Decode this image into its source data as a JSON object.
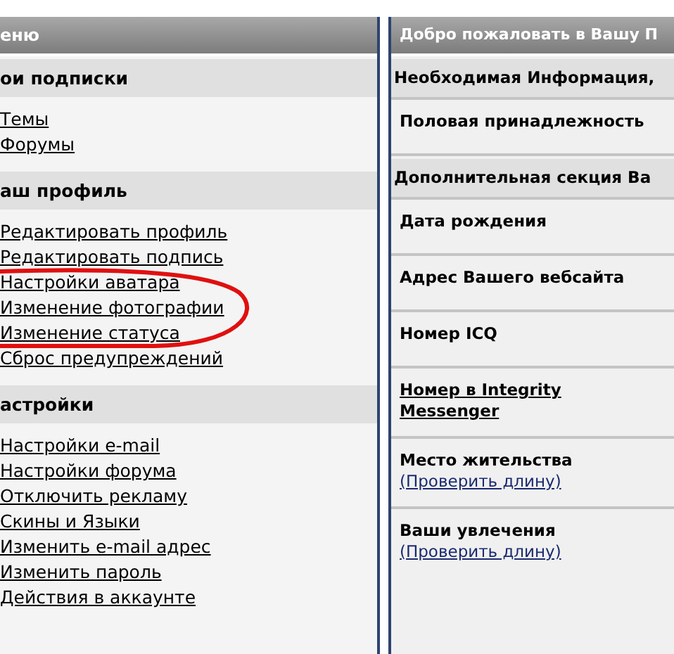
{
  "left_panel": {
    "title": "еню",
    "sections": [
      {
        "title": "ои подписки",
        "links": [
          "Темы",
          "Форумы"
        ]
      },
      {
        "title": "аш профиль",
        "links": [
          "Редактировать профиль",
          "Редактировать подпись",
          "Настройки аватара",
          "Изменение фотографии",
          "Изменение статуса",
          "Сброс предупреждений"
        ]
      },
      {
        "title": "астройки",
        "links": [
          "Настройки e-mail",
          "Настройки форума",
          "Отключить рекламу",
          "Скины и Языки",
          "Изменить e-mail адрес",
          "Изменить пароль",
          "Действия в аккаунте"
        ]
      }
    ]
  },
  "right_panel": {
    "title": "Добро пожаловать в Вашу П",
    "groups": [
      {
        "title": "Необходимая Информация,",
        "fields": [
          {
            "label": "Половая принадлежность",
            "kind": "plain"
          }
        ]
      },
      {
        "title": "Дополнительная секция Ва",
        "fields": [
          {
            "label": "Дата рождения",
            "kind": "plain"
          },
          {
            "label": "Адрес Вашего вебсайта",
            "kind": "plain"
          },
          {
            "label": "Номер ICQ",
            "kind": "plain"
          },
          {
            "label": "Номер в Integrity Messenger",
            "kind": "link"
          },
          {
            "label": "Место жительства",
            "kind": "plain",
            "check_link": "(Проверить длину)"
          },
          {
            "label": "Ваши увлечения",
            "kind": "plain",
            "check_link": "(Проверить длину)"
          }
        ]
      }
    ]
  }
}
